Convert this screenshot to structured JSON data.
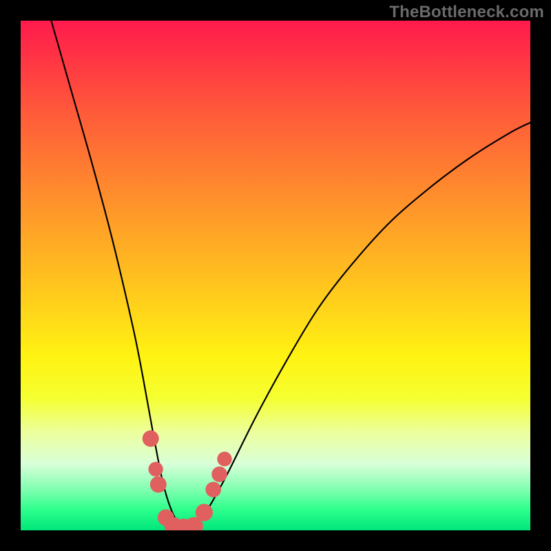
{
  "watermark": "TheBottleneck.com",
  "chart_data": {
    "type": "line",
    "title": "",
    "xlabel": "",
    "ylabel": "",
    "xlim": [
      0,
      100
    ],
    "ylim": [
      0,
      100
    ],
    "legend": false,
    "grid": false,
    "axes_visible": false,
    "series": [
      {
        "name": "bottleneck-curve",
        "x": [
          6,
          10,
          14,
          18,
          22,
          24,
          26,
          28,
          30,
          32,
          34,
          36,
          40,
          46,
          52,
          58,
          64,
          72,
          80,
          88,
          96,
          100
        ],
        "y": [
          100,
          86,
          72,
          57,
          40,
          30,
          19,
          9,
          3,
          0.5,
          0.5,
          3,
          10,
          22,
          33,
          43,
          51,
          60,
          67,
          73,
          78,
          80
        ]
      }
    ],
    "markers": [
      {
        "x": 25.5,
        "y": 18,
        "r": 1.2
      },
      {
        "x": 26.5,
        "y": 12,
        "r": 1.0
      },
      {
        "x": 27.0,
        "y": 9,
        "r": 1.2
      },
      {
        "x": 28.5,
        "y": 2.5,
        "r": 1.2
      },
      {
        "x": 30.0,
        "y": 0.8,
        "r": 1.4
      },
      {
        "x": 32.0,
        "y": 0.5,
        "r": 1.4
      },
      {
        "x": 34.0,
        "y": 0.8,
        "r": 1.4
      },
      {
        "x": 36.0,
        "y": 3.5,
        "r": 1.3
      },
      {
        "x": 37.8,
        "y": 8,
        "r": 1.1
      },
      {
        "x": 39.0,
        "y": 11,
        "r": 1.1
      },
      {
        "x": 40.0,
        "y": 14,
        "r": 1.0
      }
    ],
    "background_gradient": {
      "top": "#ff1a4d",
      "mid": "#fff312",
      "bottom": "#00e67a"
    }
  }
}
